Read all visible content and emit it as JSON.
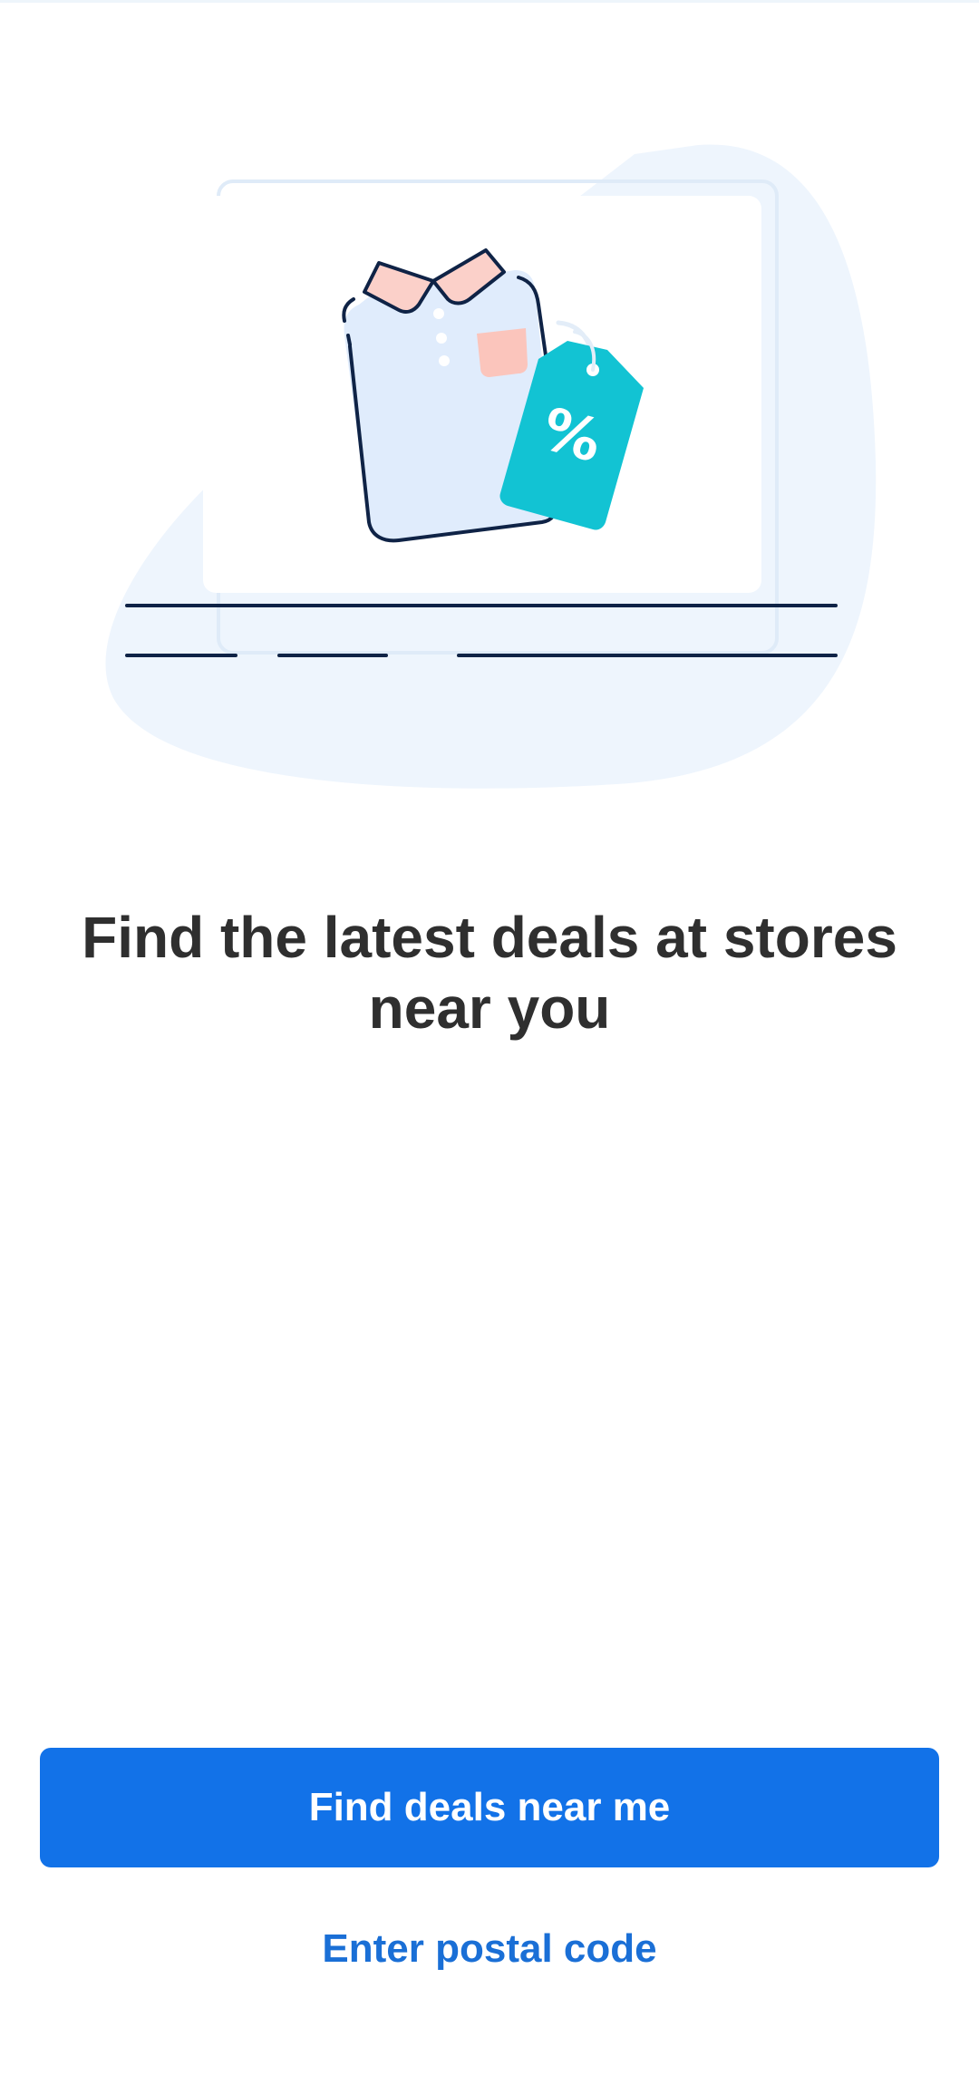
{
  "onboarding": {
    "headline": "Find the latest deals at stores near you",
    "primary_button_label": "Find deals near me",
    "secondary_link_label": "Enter postal code"
  },
  "illustration": {
    "tag_symbol": "%",
    "icons": [
      "shirt-icon",
      "price-tag-icon"
    ]
  },
  "colors": {
    "primary": "#1272e8",
    "link": "#1a6fd6",
    "headline": "#2f2f2f",
    "tag": "#12c3d3",
    "blob": "#eef5fd"
  }
}
